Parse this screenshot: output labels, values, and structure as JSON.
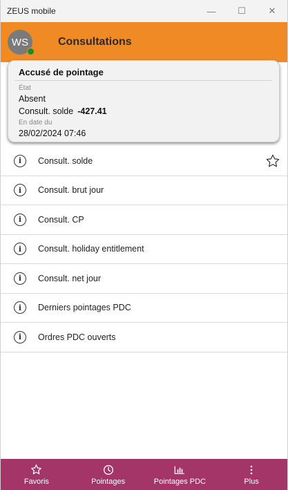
{
  "window": {
    "title": "ZEUS mobile",
    "minimize_glyph": "—",
    "maximize_glyph": "☐",
    "close_glyph": "✕"
  },
  "header": {
    "avatar_initials": "WS",
    "title": "Consultations",
    "presence_color": "#1f8a2a",
    "background_color": "#f08a25"
  },
  "card": {
    "title": "Accusé de pointage",
    "state_label": "État",
    "state_value": "Absent",
    "solde_label": "Consult. solde",
    "solde_value": "-427.41",
    "date_label": "En date du",
    "date_value": "28/02/2024 07:46"
  },
  "list": {
    "items": [
      {
        "label": "Consult. solde",
        "icon": "info-icon",
        "favorite_icon": "star-outline-icon"
      },
      {
        "label": "Consult. brut jour",
        "icon": "info-icon"
      },
      {
        "label": "Consult. CP",
        "icon": "info-icon"
      },
      {
        "label": "Consult. holiday entitlement",
        "icon": "info-icon"
      },
      {
        "label": "Consult. net jour",
        "icon": "info-icon"
      },
      {
        "label": "Derniers pointages PDC",
        "icon": "info-icon"
      },
      {
        "label": "Ordres PDC ouverts",
        "icon": "info-icon"
      }
    ]
  },
  "bottom_nav": {
    "background_color": "#a33569",
    "items": [
      {
        "label": "Favoris",
        "icon": "star-icon"
      },
      {
        "label": "Pointages",
        "icon": "clock-icon"
      },
      {
        "label": "Pointages PDC",
        "icon": "bar-chart-icon"
      },
      {
        "label": "Plus",
        "icon": "more-vertical-icon"
      }
    ]
  }
}
